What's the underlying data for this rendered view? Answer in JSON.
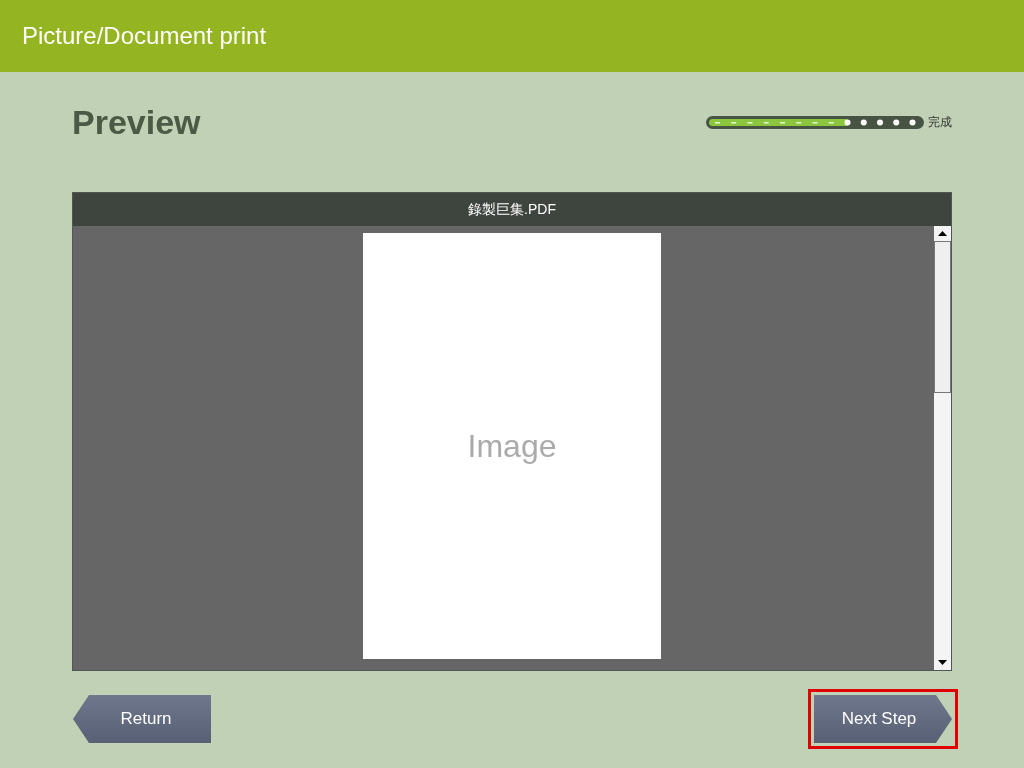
{
  "header": {
    "title": "Picture/Document print"
  },
  "page": {
    "title": "Preview"
  },
  "progress": {
    "level": 0.66,
    "end_label": "完成"
  },
  "viewer": {
    "file_name": "錄製巨集.PDF",
    "page_label": "Image"
  },
  "buttons": [
    {
      "kind": "back",
      "label": "Return",
      "highlighted": false
    },
    {
      "kind": "forward",
      "label": "Next Step",
      "highlighted": true
    }
  ]
}
